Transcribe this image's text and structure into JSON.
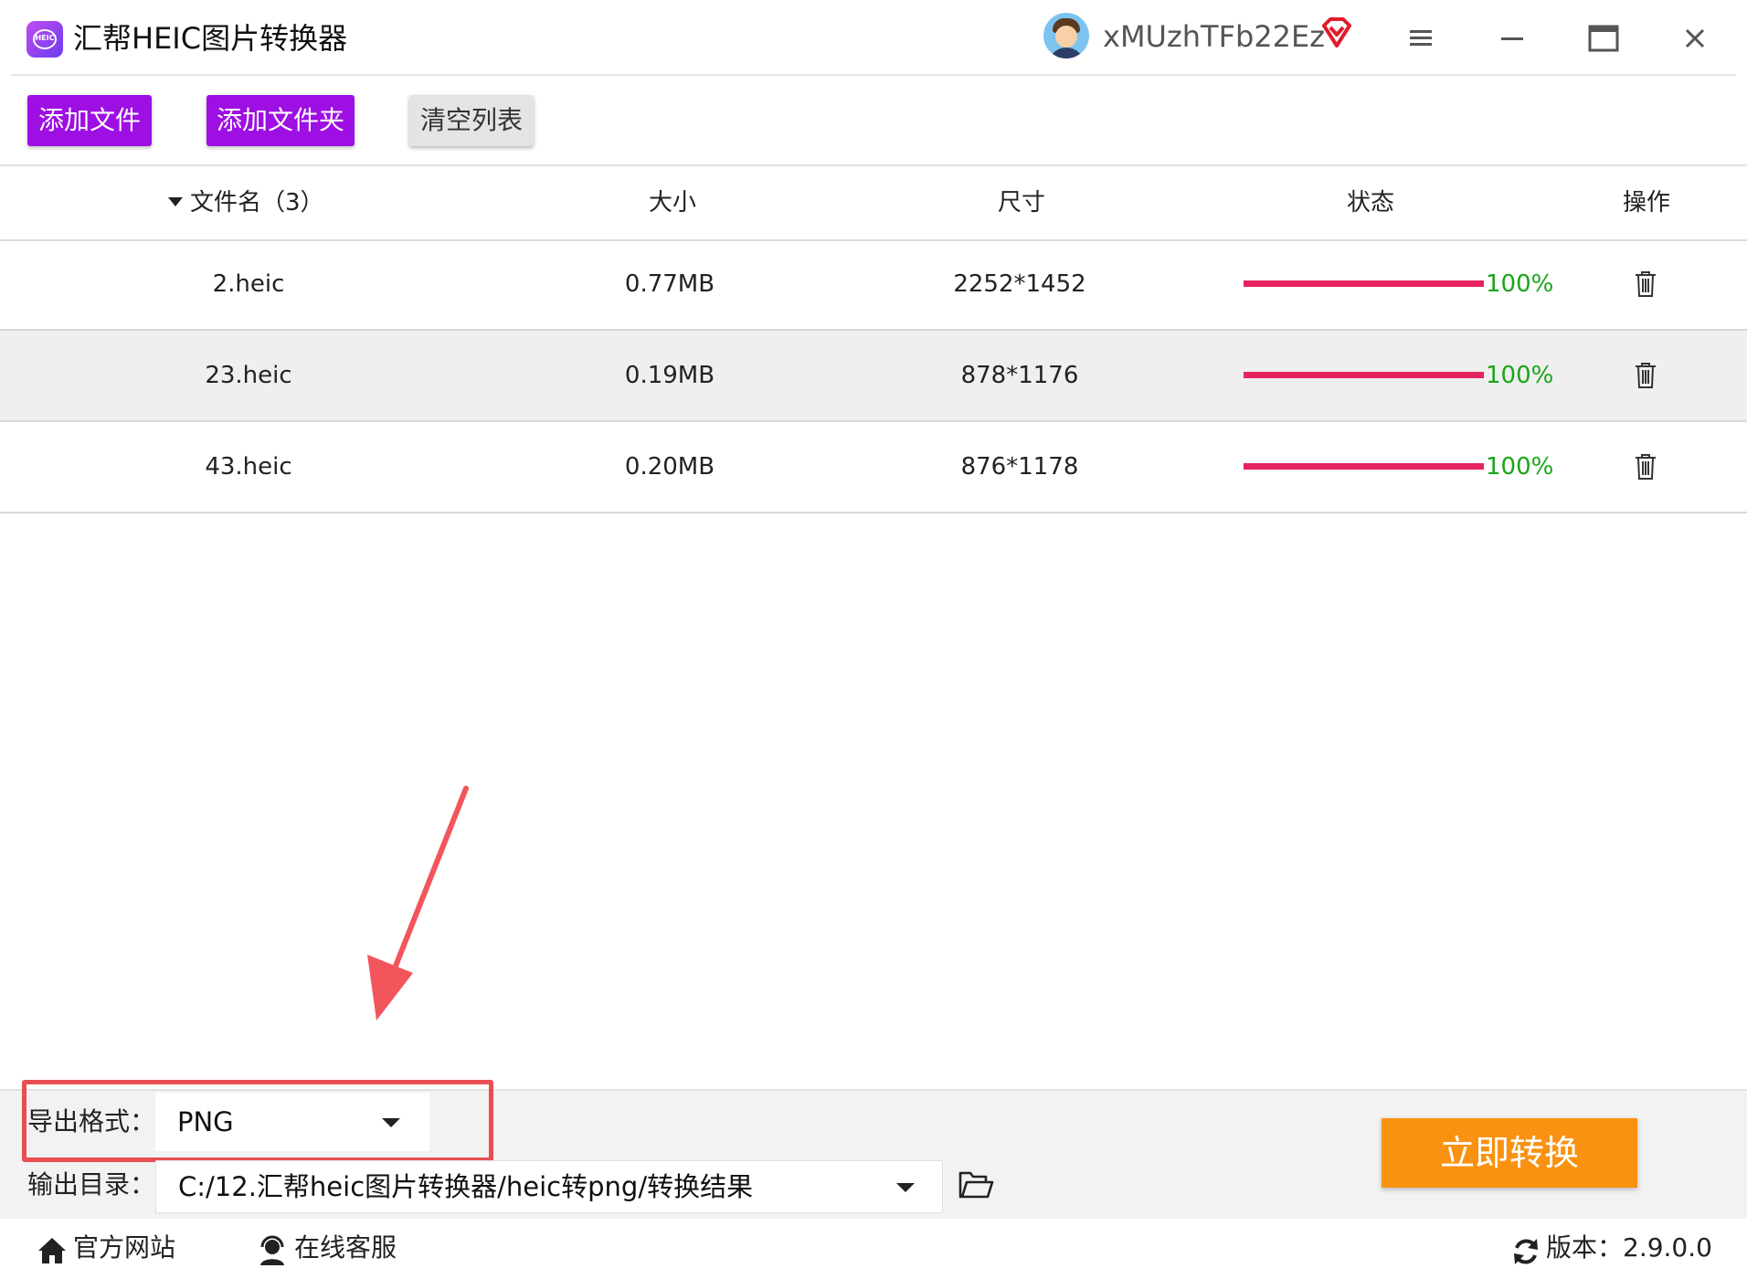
{
  "app": {
    "title": "汇帮HEIC图片转换器",
    "logo_text": "HEIC"
  },
  "user": {
    "name": "xMUzhTFb22Ez"
  },
  "toolbar": {
    "add_file": "添加文件",
    "add_folder": "添加文件夹",
    "clear_list": "清空列表"
  },
  "table": {
    "headers": {
      "name": "文件名（3）",
      "size": "大小",
      "dimensions": "尺寸",
      "status": "状态",
      "actions": "操作"
    },
    "rows": [
      {
        "name": "2.heic",
        "size": "0.77MB",
        "dimensions": "2252*1452",
        "progress": 100,
        "progress_label": "100%"
      },
      {
        "name": "23.heic",
        "size": "0.19MB",
        "dimensions": "878*1176",
        "progress": 100,
        "progress_label": "100%"
      },
      {
        "name": "43.heic",
        "size": "0.20MB",
        "dimensions": "876*1178",
        "progress": 100,
        "progress_label": "100%"
      }
    ]
  },
  "settings": {
    "format_label": "导出格式：",
    "format_value": "PNG",
    "output_label": "输出目录：",
    "output_value": "C:/12.汇帮heic图片转换器/heic转png/转换结果"
  },
  "convert_button": "立即转换",
  "footer": {
    "site": "官方网站",
    "support": "在线客服",
    "version": "版本：2.9.0.0"
  },
  "colors": {
    "accent_purple": "#9e0fe3",
    "progress": "#e6245f",
    "done_text": "#1aa51a",
    "convert": "#f99210",
    "highlight": "#e84e52"
  },
  "icons": [
    "app-logo-icon",
    "avatar",
    "vip-diamond-icon",
    "menu-icon",
    "minimize-icon",
    "maximize-icon",
    "close-icon",
    "sort-down-icon",
    "trash-icon",
    "chevron-down-icon",
    "folder-open-icon",
    "home-icon",
    "headset-icon",
    "refresh-icon"
  ]
}
